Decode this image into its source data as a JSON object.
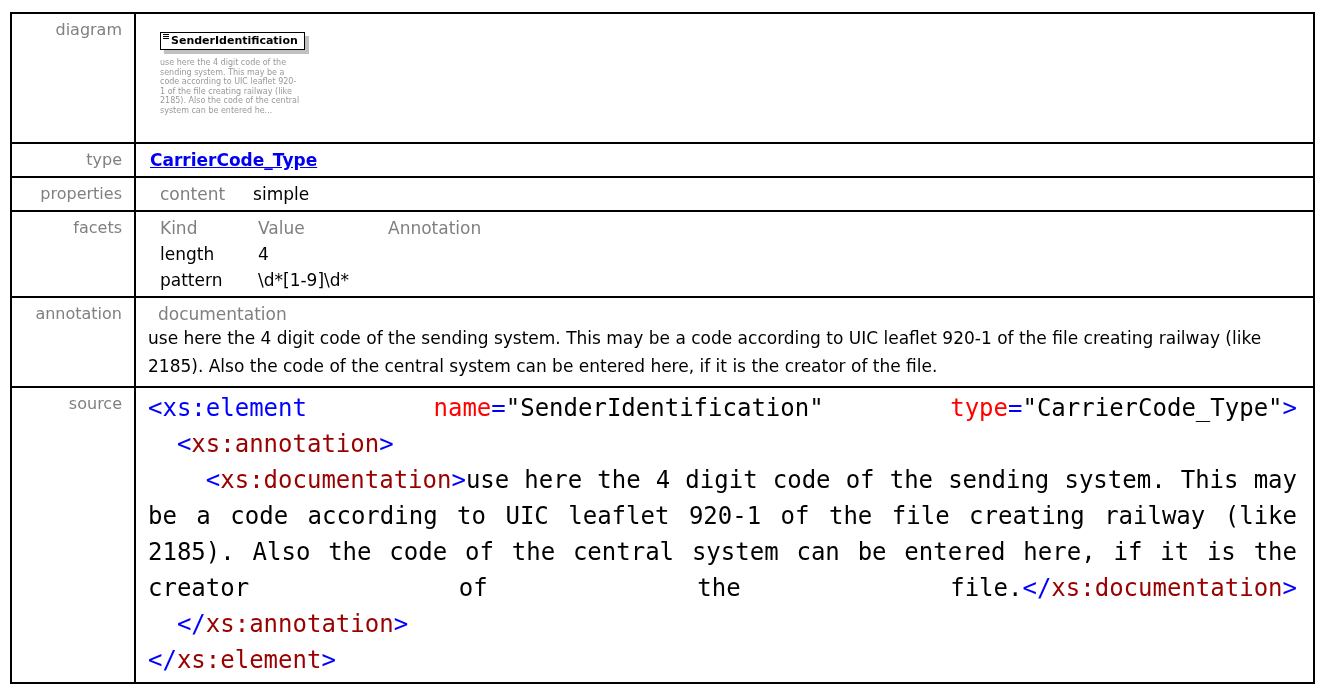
{
  "rows": [
    {
      "kind": "diagram",
      "label": "diagram",
      "element_name": "SenderIdentification",
      "description": "use here the 4 digit code of the sending system. This may be a code according to UIC leaflet 920-1 of the file creating railway (like 2185). Also the code of the central system can be entered he..."
    },
    {
      "kind": "link",
      "label": "type",
      "link": "CarrierCode_Type"
    },
    {
      "kind": "properties",
      "label": "properties",
      "items": [
        {
          "name": "content",
          "value": "simple"
        }
      ]
    },
    {
      "kind": "facets",
      "label": "facets",
      "columns": [
        "Kind",
        "Value",
        "Annotation"
      ],
      "facets": [
        {
          "kind": "length",
          "value": "4"
        },
        {
          "kind": "pattern",
          "value": "\\d*[1-9]\\d*"
        }
      ]
    },
    {
      "kind": "annotation",
      "label": "annotation",
      "heading": "documentation",
      "text": "use here the 4 digit code of the sending system. This may be a code according to UIC leaflet 920-1 of the file creating railway (like 2185). Also the code of the central system can be entered here, if it is the creator of the file."
    },
    {
      "kind": "source",
      "label": "source",
      "lines": [
        [
          {
            "kind": "tag",
            "text": "<xs:element "
          },
          {
            "kind": "attr",
            "text": "name"
          },
          {
            "kind": "tag",
            "text": "="
          },
          {
            "kind": "text",
            "text": "\"SenderIdentification\" "
          },
          {
            "kind": "attr",
            "text": "type"
          },
          {
            "kind": "tag",
            "text": "="
          },
          {
            "kind": "text",
            "text": "\"CarrierCode_Type\""
          },
          {
            "kind": "tag",
            "text": ">"
          }
        ],
        [
          {
            "kind": "tag",
            "text": "  <"
          },
          {
            "kind": "name",
            "text": "xs:annotation"
          },
          {
            "kind": "tag",
            "text": ">"
          }
        ],
        [
          {
            "kind": "tag",
            "text": "    <"
          },
          {
            "kind": "name",
            "text": "xs:documentation"
          },
          {
            "kind": "tag",
            "text": ">"
          },
          {
            "kind": "text",
            "text": "use here the 4 digit code of the sending system. This may be a code according to UIC leaflet 920-1 of the file creating railway (like 2185). Also the code of the central system can be entered here, if it is the creator of the file."
          },
          {
            "kind": "tag",
            "text": "</"
          },
          {
            "kind": "name",
            "text": "xs:documentation"
          },
          {
            "kind": "tag",
            "text": ">"
          }
        ],
        [
          {
            "kind": "tag",
            "text": "  </"
          },
          {
            "kind": "name",
            "text": "xs:annotation"
          },
          {
            "kind": "tag",
            "text": ">"
          }
        ],
        [
          {
            "kind": "tag",
            "text": "</"
          },
          {
            "kind": "name",
            "text": "xs:element"
          },
          {
            "kind": "tag",
            "text": ">"
          }
        ]
      ]
    }
  ]
}
